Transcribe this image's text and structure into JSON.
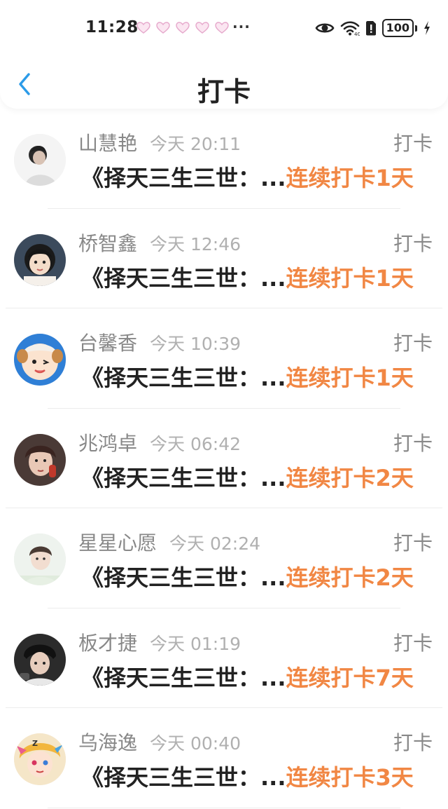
{
  "status_bar": {
    "time": "11:28",
    "more": "···",
    "battery": "100"
  },
  "header": {
    "title": "打卡"
  },
  "colors": {
    "streak": "#f18744",
    "back_arrow": "#2b9be8",
    "username": "#888888"
  },
  "entries": [
    {
      "name": "山慧艳",
      "time": "今天 20:11",
      "action": "打卡",
      "book": "《择天三生三世：...",
      "streak": "连续打卡1天",
      "avatar": "avatar-boy-dark"
    },
    {
      "name": "桥智鑫",
      "time": "今天 12:46",
      "action": "打卡",
      "book": "《择天三生三世：...",
      "streak": "连续打卡1天",
      "avatar": "avatar-girl"
    },
    {
      "name": "台馨香",
      "time": "今天 10:39",
      "action": "打卡",
      "book": "《择天三生三世：...",
      "streak": "连续打卡1天",
      "avatar": "avatar-cartoon-sheep"
    },
    {
      "name": "兆鸿卓",
      "time": "今天 06:42",
      "action": "打卡",
      "book": "《择天三生三世：...",
      "streak": "连续打卡2天",
      "avatar": "avatar-young-man"
    },
    {
      "name": "星星心愿",
      "time": "今天 02:24",
      "action": "打卡",
      "book": "《择天三生三世：...",
      "streak": "连续打卡2天",
      "avatar": "avatar-boy-light"
    },
    {
      "name": "板才捷",
      "time": "今天 01:19",
      "action": "打卡",
      "book": "《择天三生三世：...",
      "streak": "连续打卡7天",
      "avatar": "avatar-boy-cap"
    },
    {
      "name": "乌海逸",
      "time": "今天 00:40",
      "action": "打卡",
      "book": "《择天三生三世：...",
      "streak": "连续打卡3天",
      "avatar": "avatar-anime"
    }
  ]
}
